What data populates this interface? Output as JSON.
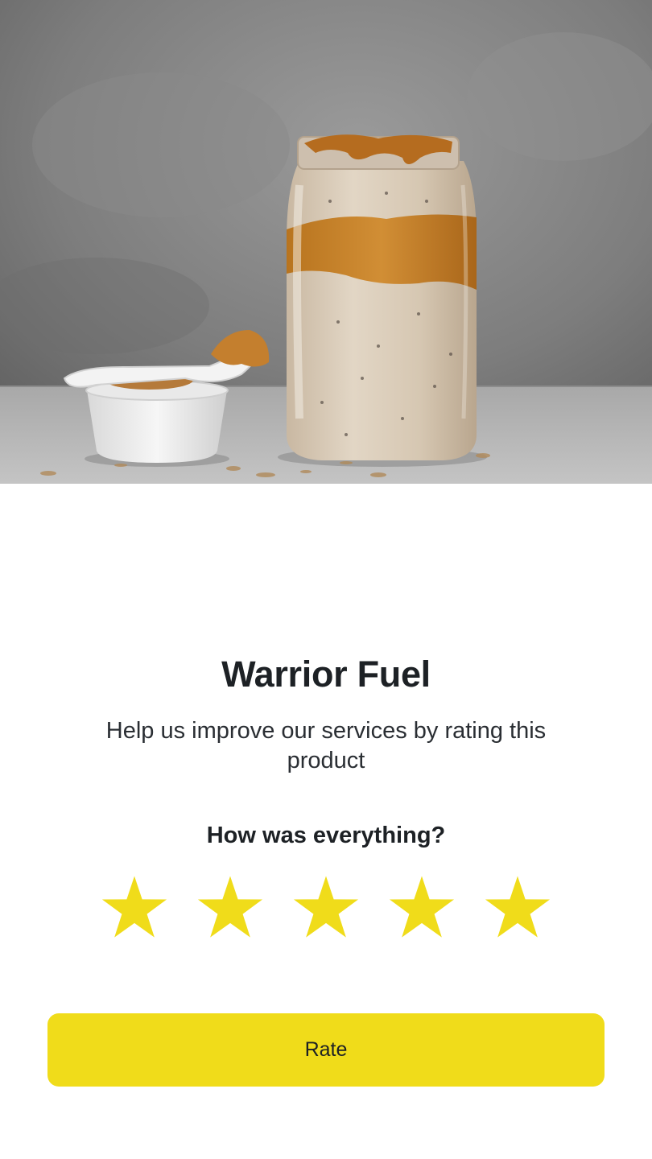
{
  "hero": {
    "image_description": "",
    "image": "overnight-oats-jar-photo"
  },
  "product": {
    "title": "Warrior Fuel",
    "subtitle": "Help us improve our services by rating this product"
  },
  "rating": {
    "question": "How was everything?",
    "max_stars": 5,
    "selected_stars": 5,
    "star_color": "#f0dc1a",
    "star_icon": "star-icon"
  },
  "actions": {
    "rate_label": "Rate",
    "rate_color": "#f0dc1a"
  }
}
